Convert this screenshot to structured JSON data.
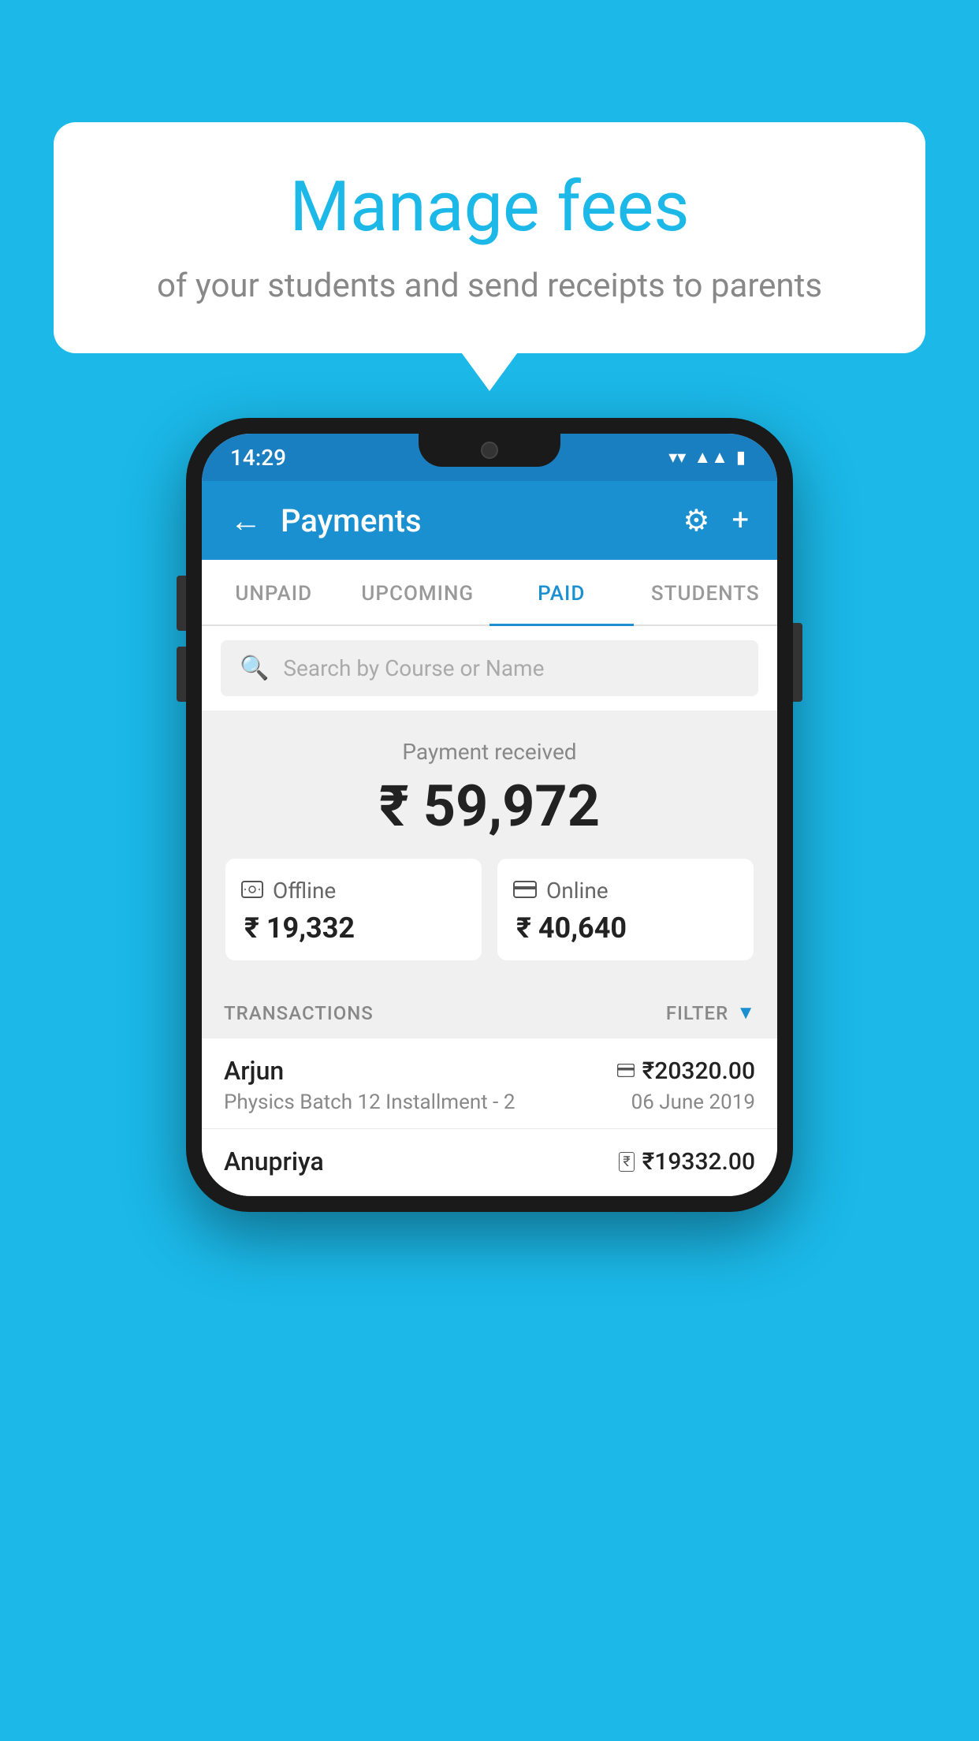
{
  "background_color": "#1BB8E8",
  "bubble": {
    "title": "Manage fees",
    "subtitle": "of your students and send receipts to parents"
  },
  "status_bar": {
    "time": "14:29",
    "icons": [
      "wifi",
      "signal",
      "battery"
    ]
  },
  "header": {
    "title": "Payments",
    "back_label": "←",
    "gear_label": "⚙",
    "plus_label": "+"
  },
  "tabs": [
    {
      "id": "unpaid",
      "label": "UNPAID",
      "active": false
    },
    {
      "id": "upcoming",
      "label": "UPCOMING",
      "active": false
    },
    {
      "id": "paid",
      "label": "PAID",
      "active": true
    },
    {
      "id": "students",
      "label": "STUDENTS",
      "active": false
    }
  ],
  "search": {
    "placeholder": "Search by Course or Name"
  },
  "payment_summary": {
    "label": "Payment received",
    "amount": "₹ 59,972",
    "offline": {
      "label": "Offline",
      "amount": "₹ 19,332"
    },
    "online": {
      "label": "Online",
      "amount": "₹ 40,640"
    }
  },
  "transactions": {
    "label": "TRANSACTIONS",
    "filter_label": "FILTER",
    "rows": [
      {
        "name": "Arjun",
        "payment_type": "card",
        "amount": "₹20320.00",
        "course": "Physics Batch 12 Installment - 2",
        "date": "06 June 2019"
      },
      {
        "name": "Anupriya",
        "payment_type": "cash",
        "amount": "₹19332.00",
        "course": "",
        "date": ""
      }
    ]
  }
}
